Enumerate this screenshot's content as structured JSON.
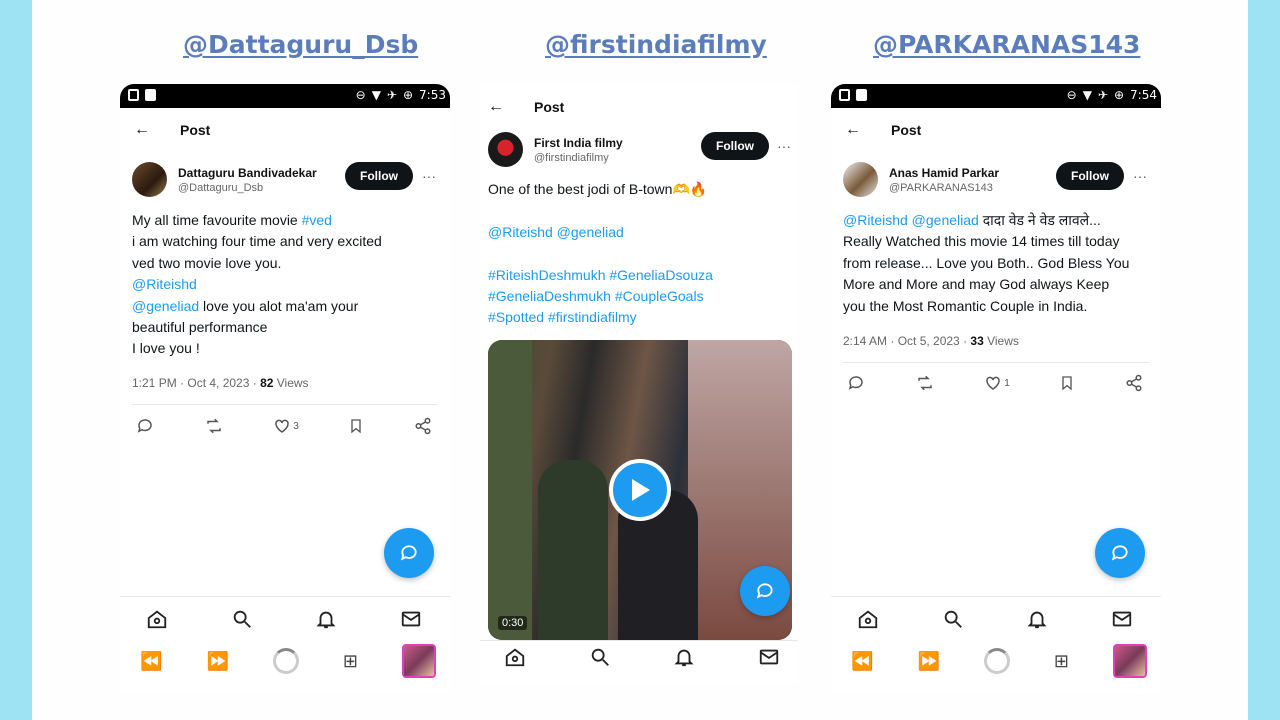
{
  "colors": {
    "page_bg": "#9ee3f4",
    "link": "#1d9bf0",
    "handle": "#5b7dbb"
  },
  "icons": [
    "back-arrow-icon",
    "more-icon",
    "reply-icon",
    "retweet-icon",
    "like-icon",
    "bookmark-icon",
    "share-icon",
    "compose-icon",
    "home-icon",
    "search-icon",
    "bell-icon",
    "mail-icon",
    "play-icon",
    "rewind-icon",
    "fast-forward-icon",
    "loading-icon",
    "gift-icon"
  ],
  "panels": [
    {
      "handle": "@Dattaguru_Dsb",
      "statusbar_time": "7:53",
      "header_title": "Post",
      "author_name": "Dattaguru Bandivadekar",
      "author_handle": "@Dattaguru_Dsb",
      "follow_label": "Follow",
      "text_lines": [
        {
          "a": "My all time favourite movie ",
          "b": "#ved"
        },
        {
          "a": " i am watching four time and very excited"
        },
        {
          "a": "ved two movie love you."
        },
        {
          "b": "@Riteishd"
        },
        {
          "b": "@geneliad",
          "c": " love you alot ma'am your"
        },
        {
          "a": "beautiful performance"
        },
        {
          "a": "I love you !"
        }
      ],
      "timestamp": "1:21 PM · Oct 4, 2023 · ",
      "views_count": "82",
      "views_label": " Views",
      "likes": "3"
    },
    {
      "handle": "@firstindiafilmy",
      "header_title": "Post",
      "author_name": "First India filmy",
      "author_handle": "@firstindiafilmy",
      "follow_label": "Follow",
      "text_line1": "One of the best jodi of B-town🫶🔥",
      "mentions": "@Riteishd @geneliad",
      "hashtags_1": "#RiteishDeshmukh #GeneliaDsouza",
      "hashtags_2": "#GeneliaDeshmukh #CoupleGoals",
      "hashtags_3": "#Spotted #firstindiafilmy",
      "video_duration": "0:30"
    },
    {
      "handle": "@PARKARANAS143",
      "statusbar_time": "7:54",
      "header_title": "Post",
      "author_name": "Anas Hamid Parkar",
      "author_handle": "@PARKARANAS143",
      "follow_label": "Follow",
      "text_lines": [
        {
          "b": "@Riteishd @geneliad",
          "c": " दादा वेड ने वेड लावले..."
        },
        {
          "a": "Really Watched this movie 14 times till today"
        },
        {
          "a": "from release... Love you Both.. God Bless You"
        },
        {
          "a": "More and More and may God always Keep"
        },
        {
          "a": "you the Most Romantic Couple in India."
        }
      ],
      "timestamp": "2:14 AM · Oct 5, 2023 · ",
      "views_count": "33",
      "views_label": " Views",
      "likes": "1"
    }
  ]
}
